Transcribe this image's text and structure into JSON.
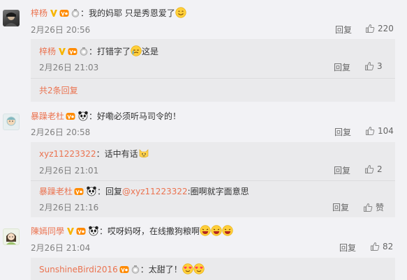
{
  "comments": [
    {
      "name": "梓杨",
      "text": "：我的妈耶 只是秀恩爱了",
      "time": "2月26日 20:56",
      "reply_label": "回复",
      "likes": "220",
      "replies": [
        {
          "name": "梓杨",
          "text": "：打错字了",
          "text2": "这是",
          "time": "2月26日 21:03",
          "reply_label": "回复",
          "likes": "3"
        }
      ],
      "more": "共2条回复"
    },
    {
      "name": "暴躁老杜",
      "text": "：好嘞必须听马司令的！",
      "time": "2月26日 20:58",
      "reply_label": "回复",
      "likes": "104",
      "replies": [
        {
          "name": "xyz11223322",
          "text": "：话中有话",
          "time": "2月26日 21:01",
          "reply_label": "回复",
          "likes": "2"
        },
        {
          "name": "暴躁老杜",
          "text_prefix": "：回复",
          "mention": "@xyz11223322",
          "text": ":圈啊就字面意思",
          "time": "2月26日 21:16",
          "reply_label": "回复",
          "likes": "赞"
        }
      ]
    },
    {
      "name": "陳嫣同學",
      "text": "：哎呀妈呀，在线撒狗粮啊",
      "time": "2月26日 21:04",
      "reply_label": "回复",
      "likes": "82",
      "replies": [
        {
          "name": "SunshineBirdi2016",
          "text": "：太甜了！"
        }
      ]
    }
  ]
}
